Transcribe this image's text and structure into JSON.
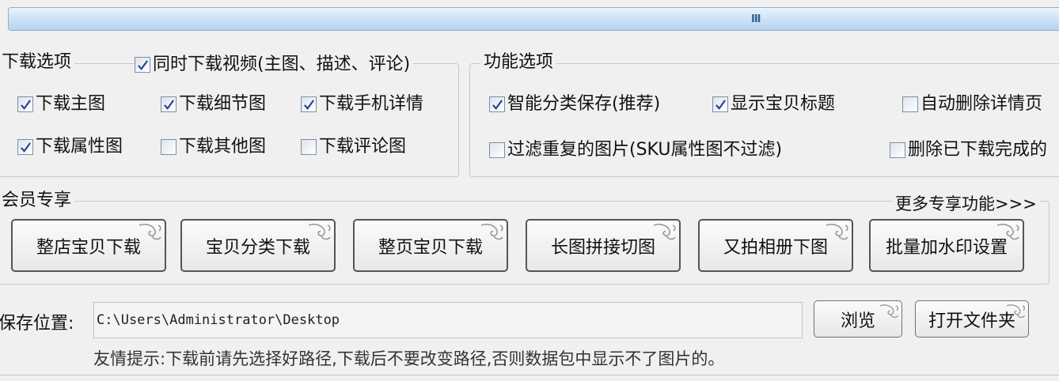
{
  "scrollbar": {
    "grip": "III"
  },
  "download_options": {
    "title": "下载选项",
    "simultaneous_video": {
      "label": "同时下载视频(主图、描述、评论)",
      "checked": true
    },
    "items": [
      {
        "label": "下载主图",
        "checked": true
      },
      {
        "label": "下载细节图",
        "checked": true
      },
      {
        "label": "下载手机详情",
        "checked": true
      },
      {
        "label": "下载属性图",
        "checked": true
      },
      {
        "label": "下载其他图",
        "checked": false
      },
      {
        "label": "下载评论图",
        "checked": false
      }
    ]
  },
  "function_options": {
    "title": "功能选项",
    "items": [
      {
        "label": "智能分类保存(推荐)",
        "checked": true
      },
      {
        "label": "显示宝贝标题",
        "checked": true
      },
      {
        "label": "自动删除详情页",
        "checked": false
      },
      {
        "label": "过滤重复的图片(SKU属性图不过滤)",
        "checked": false
      },
      {
        "label": "删除已下载完成的",
        "checked": false
      }
    ]
  },
  "vip": {
    "title": "会员专享",
    "more_link": "更多专享功能>>>",
    "buttons": [
      "整店宝贝下载",
      "宝贝分类下载",
      "整页宝贝下载",
      "长图拼接切图",
      "又拍相册下图",
      "批量加水印设置"
    ]
  },
  "save": {
    "label": "保存位置:",
    "path": "C:\\Users\\Administrator\\Desktop",
    "browse": "浏览",
    "open_folder": "打开文件夹"
  },
  "hint": "友情提示:下载前请先选择好路径,下载后不要改变路径,否则数据包中显示不了图片的。",
  "icons": {
    "checkbox_check": "check-icon",
    "button_ornament": "swirl-ornament-icon"
  },
  "colors": {
    "check": "#1c3f9a",
    "scroll_track": "#c9e1f4",
    "background": "#f0f0f0"
  }
}
